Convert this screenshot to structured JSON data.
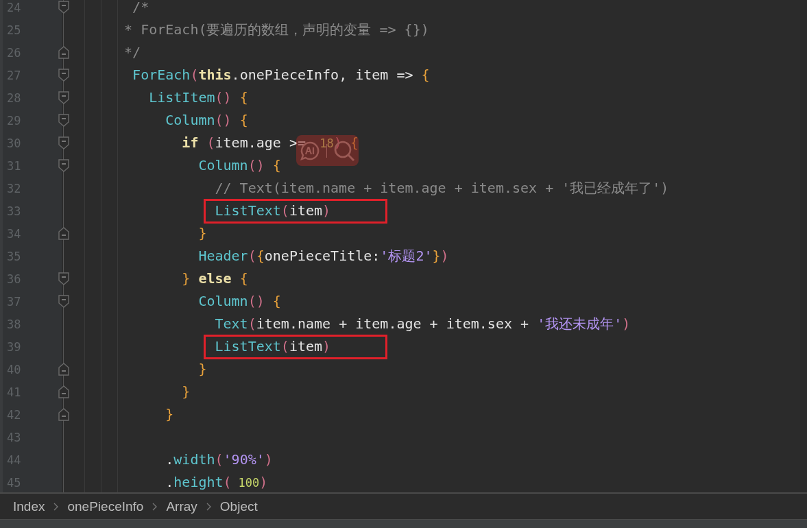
{
  "editor": {
    "lines": [
      {
        "number": "24",
        "fold_start": true,
        "fold_end": false,
        "tokens": [
          {
            "kind": "comment",
            "text": " /*"
          }
        ]
      },
      {
        "number": "25",
        "fold_start": false,
        "fold_end": false,
        "tokens": [
          {
            "kind": "comment",
            "text": "* ForEach(要遍历的数组，声明的变量 => {})"
          }
        ]
      },
      {
        "number": "26",
        "fold_start": false,
        "fold_end": true,
        "tokens": [
          {
            "kind": "comment",
            "text": "*/"
          }
        ]
      },
      {
        "number": "27",
        "fold_start": true,
        "fold_end": false,
        "tokens": [
          {
            "kind": "fn",
            "text": " ForEach"
          },
          {
            "kind": "paren",
            "text": "("
          },
          {
            "kind": "kw",
            "text": "this"
          },
          {
            "kind": "plain",
            "text": ".onePieceInfo, item => "
          },
          {
            "kind": "brace",
            "text": "{"
          }
        ]
      },
      {
        "number": "28",
        "fold_start": true,
        "fold_end": false,
        "tokens": [
          {
            "kind": "fn",
            "text": "   ListItem"
          },
          {
            "kind": "paren",
            "text": "()"
          },
          {
            "kind": "brace",
            "text": " {"
          }
        ]
      },
      {
        "number": "29",
        "fold_start": true,
        "fold_end": false,
        "tokens": [
          {
            "kind": "fn",
            "text": "     Column"
          },
          {
            "kind": "paren",
            "text": "()"
          },
          {
            "kind": "brace",
            "text": " {"
          }
        ]
      },
      {
        "number": "30",
        "fold_start": true,
        "fold_end": false,
        "tokens": [
          {
            "kind": "kw",
            "text": "       if"
          },
          {
            "kind": "paren",
            "text": " ("
          },
          {
            "kind": "plain",
            "text": "item.age"
          },
          {
            "kind": "plain",
            "text": " >="
          },
          {
            "kind": "num",
            "text": " 18"
          },
          {
            "kind": "paren",
            "text": ")"
          },
          {
            "kind": "brace",
            "text": " {"
          }
        ]
      },
      {
        "number": "31",
        "fold_start": true,
        "fold_end": false,
        "tokens": [
          {
            "kind": "fn",
            "text": "         Column"
          },
          {
            "kind": "paren",
            "text": "()"
          },
          {
            "kind": "brace",
            "text": " {"
          }
        ]
      },
      {
        "number": "32",
        "fold_start": false,
        "fold_end": false,
        "tokens": [
          {
            "kind": "comment",
            "text": "           // Text(item.name + item.age + item.sex + '我已经成年了')"
          }
        ]
      },
      {
        "number": "33",
        "fold_start": false,
        "fold_end": false,
        "highlighted": true,
        "tokens": [
          {
            "kind": "fn",
            "text": "           ListText"
          },
          {
            "kind": "paren",
            "text": "("
          },
          {
            "kind": "plain",
            "text": "item"
          },
          {
            "kind": "paren",
            "text": ")"
          }
        ]
      },
      {
        "number": "34",
        "fold_start": false,
        "fold_end": true,
        "tokens": [
          {
            "kind": "brace",
            "text": "         }"
          }
        ]
      },
      {
        "number": "35",
        "fold_start": false,
        "fold_end": false,
        "tokens": [
          {
            "kind": "fn",
            "text": "         Header"
          },
          {
            "kind": "paren",
            "text": "("
          },
          {
            "kind": "brace",
            "text": "{"
          },
          {
            "kind": "plain",
            "text": "onePieceTitle:"
          },
          {
            "kind": "str",
            "text": "'标题2'"
          },
          {
            "kind": "brace",
            "text": "}"
          },
          {
            "kind": "paren",
            "text": ")"
          }
        ]
      },
      {
        "number": "36",
        "fold_start": true,
        "fold_end": false,
        "tokens": [
          {
            "kind": "brace",
            "text": "       }"
          },
          {
            "kind": "kw",
            "text": " else"
          },
          {
            "kind": "brace",
            "text": " {"
          }
        ]
      },
      {
        "number": "37",
        "fold_start": true,
        "fold_end": false,
        "tokens": [
          {
            "kind": "fn",
            "text": "         Column"
          },
          {
            "kind": "paren",
            "text": "()"
          },
          {
            "kind": "brace",
            "text": " {"
          }
        ]
      },
      {
        "number": "38",
        "fold_start": false,
        "fold_end": false,
        "tokens": [
          {
            "kind": "fn",
            "text": "           Text"
          },
          {
            "kind": "paren",
            "text": "("
          },
          {
            "kind": "plain",
            "text": "item.name + item.age + item.sex + "
          },
          {
            "kind": "str",
            "text": "'我还未成年'"
          },
          {
            "kind": "paren",
            "text": ")"
          }
        ]
      },
      {
        "number": "39",
        "fold_start": false,
        "fold_end": false,
        "highlighted": true,
        "tokens": [
          {
            "kind": "fn",
            "text": "           ListText"
          },
          {
            "kind": "paren",
            "text": "("
          },
          {
            "kind": "plain",
            "text": "item"
          },
          {
            "kind": "paren",
            "text": ")"
          }
        ]
      },
      {
        "number": "40",
        "fold_start": false,
        "fold_end": true,
        "tokens": [
          {
            "kind": "brace",
            "text": "         }"
          }
        ]
      },
      {
        "number": "41",
        "fold_start": false,
        "fold_end": true,
        "tokens": [
          {
            "kind": "brace",
            "text": "       }"
          }
        ]
      },
      {
        "number": "42",
        "fold_start": false,
        "fold_end": true,
        "tokens": [
          {
            "kind": "brace",
            "text": "     }"
          }
        ]
      },
      {
        "number": "43",
        "fold_start": false,
        "fold_end": false
      },
      {
        "number": "44",
        "fold_start": false,
        "fold_end": false,
        "tokens": [
          {
            "kind": "plain",
            "text": "     ."
          },
          {
            "kind": "fn",
            "text": "width"
          },
          {
            "kind": "paren",
            "text": "("
          },
          {
            "kind": "str",
            "text": "'90%'"
          },
          {
            "kind": "paren",
            "text": ")"
          }
        ]
      },
      {
        "number": "45",
        "fold_start": false,
        "fold_end": false,
        "tokens": [
          {
            "kind": "plain",
            "text": "     ."
          },
          {
            "kind": "fn",
            "text": "height"
          },
          {
            "kind": "paren",
            "text": "("
          },
          {
            "kind": "num",
            "text": "100"
          },
          {
            "kind": "paren",
            "text": ")"
          }
        ]
      }
    ]
  },
  "breadcrumb": [
    "Index",
    "onePieceInfo",
    "Array",
    "Object"
  ]
}
